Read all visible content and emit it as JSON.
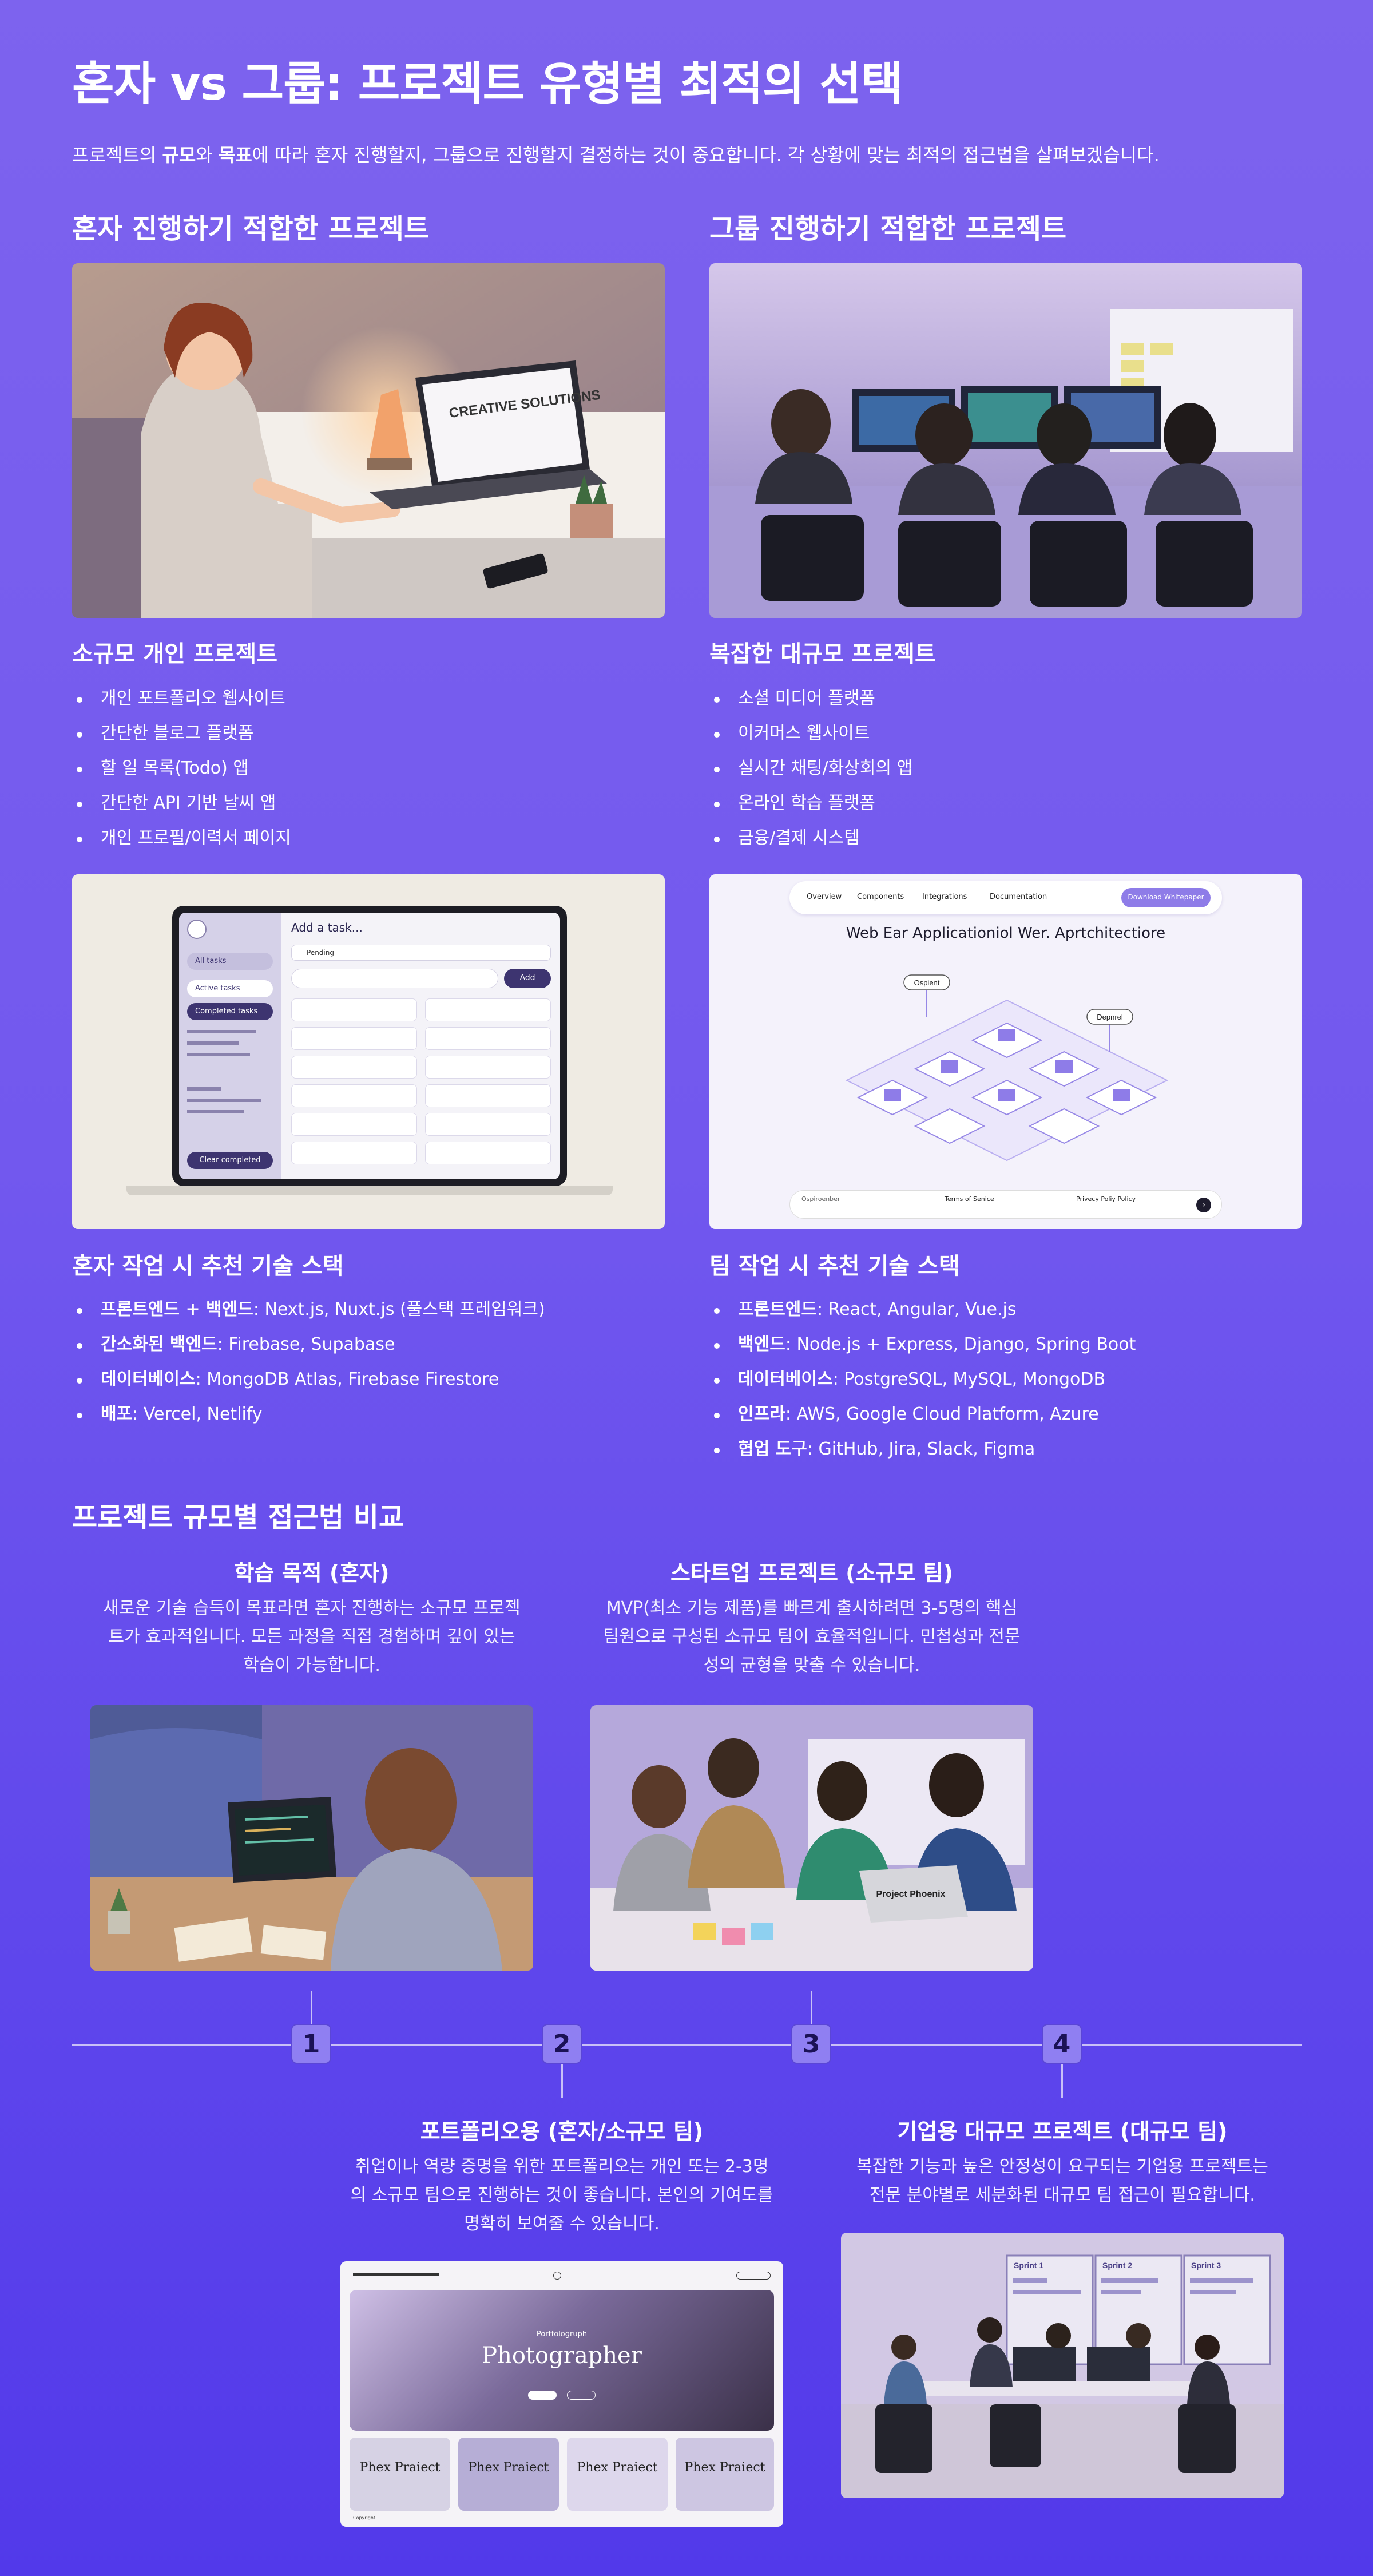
{
  "title": "혼자 vs 그룹: 프로젝트 유형별 최적의 선택",
  "intro": {
    "p1": "프로젝트의 ",
    "b1": "규모",
    "p2": "와 ",
    "b2": "목표",
    "p3": "에 따라 혼자 진행할지, 그룹으로 진행할지 결정하는 것이 중요합니다. 각 상황에 맞는 최적의 접근법을 살펴보겠습니다."
  },
  "solo": {
    "heading": "혼자 진행하기 적합한 프로젝트",
    "photo_text": "CREATIVE SOLUTIONS",
    "sub": "소규모 개인 프로젝트",
    "items": [
      "개인 포트폴리오 웹사이트",
      "간단한 블로그 플랫폼",
      "할 일 목록(Todo) 앱",
      "간단한 API 기반 날씨 앱",
      "개인 프로필/이력서 페이지"
    ],
    "app": {
      "add_task": "Add a task...",
      "all_tasks": "All tasks",
      "active_tasks": "Active tasks",
      "completed_tasks": "Completed tasks",
      "pending": "Pending",
      "add": "Add",
      "clear_completed": "Clear completed"
    },
    "stack_heading": "혼자 작업 시 추천 기술 스택",
    "stack": [
      {
        "k": "프론트엔드 + 백엔드",
        "v": ": Next.js, Nuxt.js (풀스택 프레임워크)"
      },
      {
        "k": "간소화된 백엔드",
        "v": ": Firebase, Supabase"
      },
      {
        "k": "데이터베이스",
        "v": ": MongoDB Atlas, Firebase Firestore"
      },
      {
        "k": "배포",
        "v": ": Vercel, Netlify"
      }
    ]
  },
  "group": {
    "heading": "그룹 진행하기 적합한 프로젝트",
    "sub": "복잡한 대규모 프로젝트",
    "items": [
      "소셜 미디어 플랫폼",
      "이커머스 웹사이트",
      "실시간 채팅/화상회의 앱",
      "온라인 학습 플랫폼",
      "금융/결제 시스템"
    ],
    "web": {
      "nav": [
        "Overview",
        "Components",
        "Integrations",
        "Documentation"
      ],
      "cta": "Download Whitepaper",
      "headline": "Web Ear Applicationiol Wer. Aprtchitectiore",
      "label1": "Ospient",
      "label2": "Depnrel",
      "footer": [
        "Ospiroenber",
        "Terms of Senice",
        "Privecy Poliy Policy"
      ]
    },
    "stack_heading": "팀 작업 시 추천 기술 스택",
    "stack": [
      {
        "k": "프론트엔드",
        "v": ": React, Angular, Vue.js"
      },
      {
        "k": "백엔드",
        "v": ": Node.js + Express, Django, Spring Boot"
      },
      {
        "k": "데이터베이스",
        "v": ": PostgreSQL, MySQL, MongoDB"
      },
      {
        "k": "인프라",
        "v": ": AWS, Google Cloud Platform, Azure"
      },
      {
        "k": "협업 도구",
        "v": ": GitHub, Jira, Slack, Figma"
      }
    ]
  },
  "compare": {
    "heading": "프로젝트 규모별 접근법 비교",
    "stages": [
      {
        "num": "1",
        "title": "학습 목적 (혼자)",
        "desc": [
          "새로운 기술 습득이 목표라면 혼자 진행하는 소규모 프로젝",
          "트가 효과적입니다. 모든 과정을 직접 경험하며 깊이 있는",
          "학습이 가능합니다."
        ]
      },
      {
        "num": "2",
        "title": "포트폴리오용 (혼자/소규모 팀)",
        "desc": [
          "취업이나 역량 증명을 위한 포트폴리오는 개인 또는 2-3명",
          "의 소규모 팀으로 진행하는 것이 좋습니다. 본인의 기여도를",
          "명확히 보여줄 수 있습니다."
        ]
      },
      {
        "num": "3",
        "title": "스타트업 프로젝트 (소규모 팀)",
        "desc": [
          "MVP(최소 기능 제품)를 빠르게 출시하려면 3-5명의 핵심",
          "팀원으로 구성된 소규모 팀이 효율적입니다. 민첩성과 전문",
          "성의 균형을 맞출 수 있습니다."
        ]
      },
      {
        "num": "4",
        "title": "기업용 대규모 프로젝트 (대규모 팀)",
        "desc": [
          "복잡한 기능과 높은 안정성이 요구되는 기업용 프로젝트는",
          "전문 분야별로 세분화된 대규모 팀 접근이 필요합니다."
        ]
      }
    ],
    "startup_laptop": "Project Phoenix",
    "portfolio": {
      "hero_small": "Portfologruph",
      "hero": "Photographer",
      "cards": [
        "Phex Praiect",
        "Phex Praiect",
        "Phex Praiect",
        "Phex Praiect"
      ],
      "footer": "Copyright"
    },
    "enterprise_boards": [
      "Sprint 1",
      "Sprint 2",
      "Sprint 3"
    ]
  },
  "colors": {
    "bg_top": "#7d63ee",
    "bg_bottom": "#5239ea",
    "timeline_node": "#8f7ff2",
    "accent_dark": "#3d3470"
  }
}
